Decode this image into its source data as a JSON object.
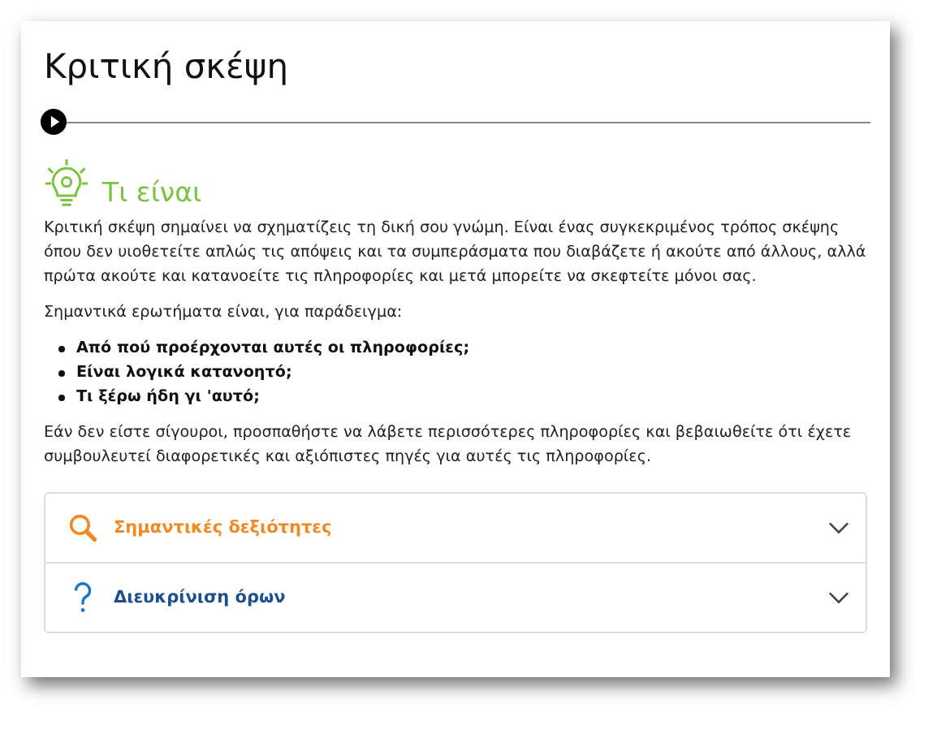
{
  "page": {
    "title": "Κριτική σκέψη"
  },
  "audio_player": {
    "playing": false
  },
  "section": {
    "heading": "Τι είναι",
    "paragraphs_before": [
      "Κριτική σκέψη σημαίνει να σχηματίζεις τη δική σου γνώμη. Είναι ένας συγκεκριμένος τρόπος σκέψης όπου δεν υιοθετείτε απλώς τις απόψεις και τα συμπεράσματα που διαβάζετε ή ακούτε από άλλους, αλλά πρώτα ακούτε και κατανοείτε τις πληροφορίες και μετά μπορείτε να σκεφτείτε μόνοι σας.",
      "Σημαντικά ερωτήματα είναι, για παράδειγμα:"
    ],
    "bullets": [
      "Από πού προέρχονται αυτές οι πληροφορίες;",
      "Είναι λογικά κατανοητό;",
      "Τι ξέρω ήδη γι 'αυτό;"
    ],
    "paragraphs_after": [
      "Εάν δεν είστε σίγουροι, προσπαθήστε να λάβετε περισσότερες πληροφορίες και βεβαιωθείτε ότι έχετε συμβουλευτεί διαφορετικές και αξιόπιστες πηγές για αυτές τις πληροφορίες."
    ]
  },
  "accordion": [
    {
      "kind": "search",
      "title": "Σημαντικές δεξιότητες",
      "color": "#f08a24",
      "expanded": false
    },
    {
      "kind": "question",
      "title": "Διευκρίνιση όρων",
      "color": "#1d4f8c",
      "expanded": false
    }
  ]
}
